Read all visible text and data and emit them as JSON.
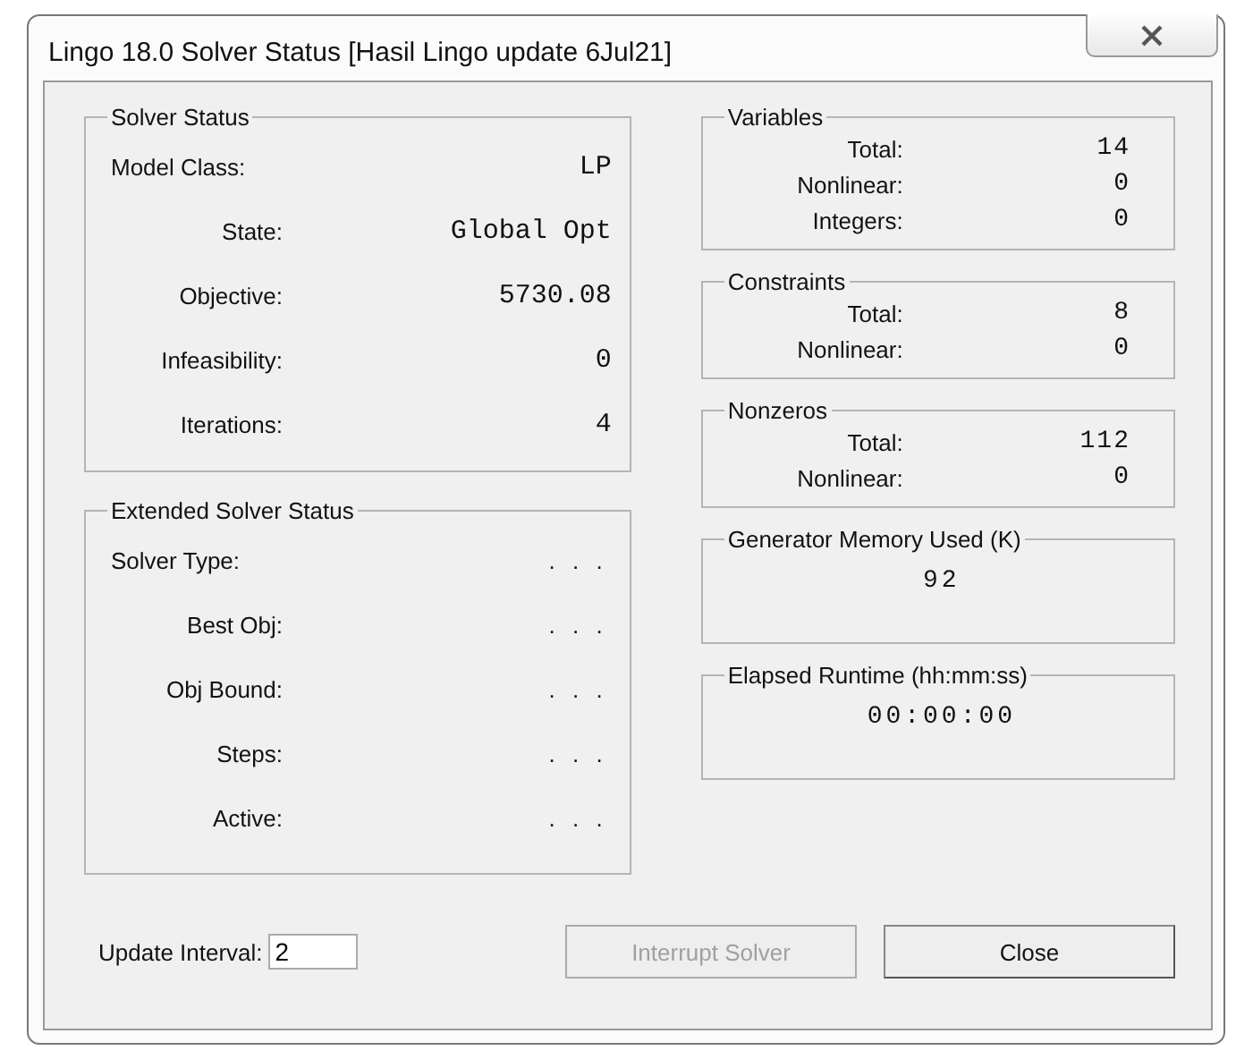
{
  "window": {
    "title": "Lingo 18.0 Solver Status [Hasil Lingo update 6Jul21]"
  },
  "solver_status": {
    "title": "Solver Status",
    "rows": [
      {
        "label": "Model Class:",
        "value": "LP"
      },
      {
        "label": "State:",
        "value": "Global Opt"
      },
      {
        "label": "Objective:",
        "value": "5730.08"
      },
      {
        "label": "Infeasibility:",
        "value": "0"
      },
      {
        "label": "Iterations:",
        "value": "4"
      }
    ]
  },
  "extended_solver_status": {
    "title": "Extended Solver Status",
    "rows": [
      {
        "label": "Solver Type:",
        "value": ". . ."
      },
      {
        "label": "Best Obj:",
        "value": ". . ."
      },
      {
        "label": "Obj Bound:",
        "value": ". . ."
      },
      {
        "label": "Steps:",
        "value": ". . ."
      },
      {
        "label": "Active:",
        "value": ". . ."
      }
    ]
  },
  "count_groups": [
    {
      "title": "Variables",
      "rows": [
        {
          "label": "Total:",
          "value": "14"
        },
        {
          "label": "Nonlinear:",
          "value": "0"
        },
        {
          "label": "Integers:",
          "value": "0"
        }
      ]
    },
    {
      "title": "Constraints",
      "rows": [
        {
          "label": "Total:",
          "value": "8"
        },
        {
          "label": "Nonlinear:",
          "value": "0"
        }
      ]
    },
    {
      "title": "Nonzeros",
      "rows": [
        {
          "label": "Total:",
          "value": "112"
        },
        {
          "label": "Nonlinear:",
          "value": "0"
        }
      ]
    }
  ],
  "value_groups": [
    {
      "title": "Generator Memory Used (K)",
      "value": "92"
    },
    {
      "title": "Elapsed Runtime (hh:mm:ss)",
      "value": "00:00:00"
    }
  ],
  "update_interval": {
    "label": "Update Interval:",
    "value": "2"
  },
  "buttons": [
    {
      "label": "Interrupt Solver",
      "disabled": true
    },
    {
      "label": "Close",
      "disabled": false
    }
  ]
}
